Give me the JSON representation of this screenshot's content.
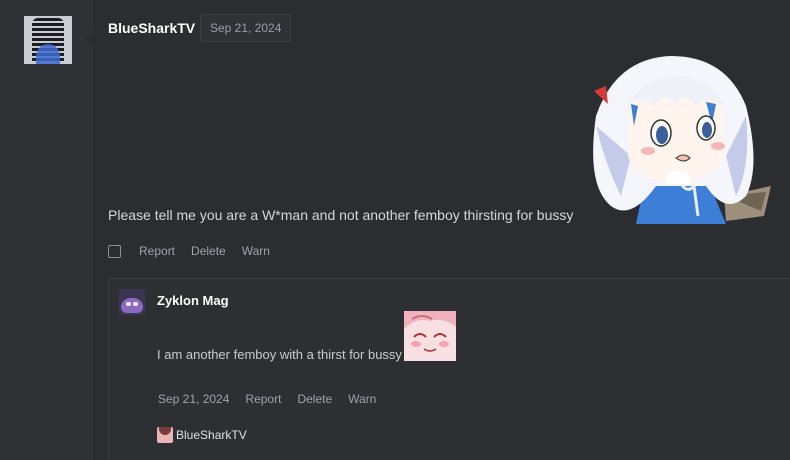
{
  "post": {
    "author": "BlueSharkTV",
    "date": "Sep 21, 2024",
    "text": "Please tell me you are a W*man and not another femboy thirsting for bussy",
    "actions": [
      "Report",
      "Delete",
      "Warn"
    ],
    "avatar_icon": "masked-user-avatar",
    "sticker": "anime-girl-sticker"
  },
  "reply": {
    "author": "Zyklon Mag",
    "text": "I am another femboy with a thirst for bussy",
    "date": "Sep 21, 2024",
    "actions": [
      "Report",
      "Delete",
      "Warn"
    ],
    "mention": "BlueSharkTV",
    "sticker": "pink-anime-face-sticker"
  },
  "colors": {
    "background": "#2b2d30",
    "sidebar": "#2f3134",
    "text": "#d6d6d6",
    "muted": "#a0a3a8",
    "username": "#ffffff"
  }
}
